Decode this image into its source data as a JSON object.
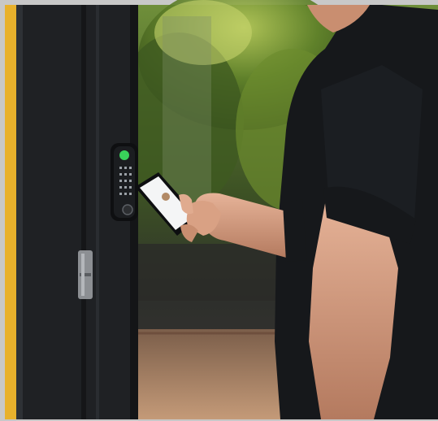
{
  "scene": {
    "subject": "person-unlocking-door-with-phone",
    "colors": {
      "frame": "#c8c8c8",
      "accent_bar": "#e8b12c",
      "door": "#1f2124",
      "foliage": "#4f6d25",
      "shirt": "#16181b",
      "skin": "#d9a184",
      "led": "#39d25a"
    }
  },
  "icons": {
    "keypad": "keypad-lock-icon",
    "phone": "smartphone-icon",
    "hinge": "door-hinge-icon"
  }
}
